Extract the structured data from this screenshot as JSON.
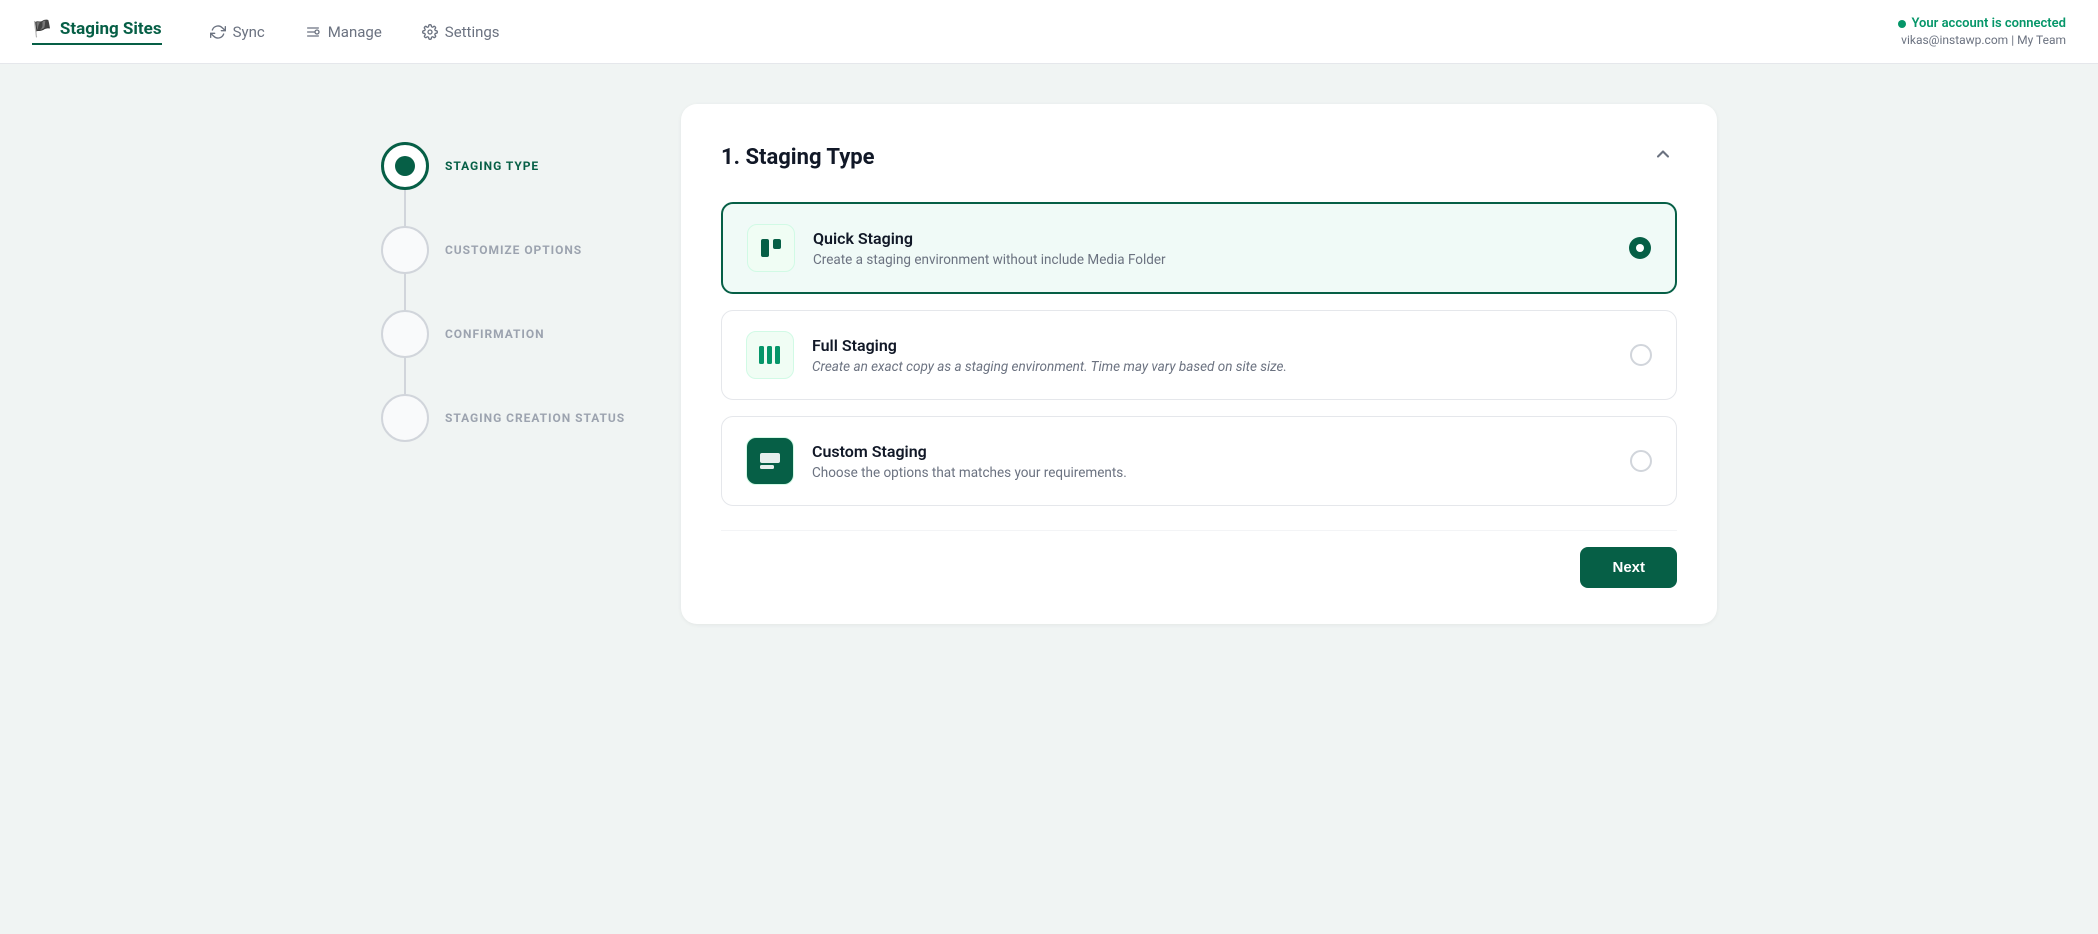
{
  "navbar": {
    "brand": "Staging Sites",
    "nav_items": [
      {
        "id": "sync",
        "label": "Sync",
        "icon": "sync"
      },
      {
        "id": "manage",
        "label": "Manage",
        "icon": "manage"
      },
      {
        "id": "settings",
        "label": "Settings",
        "icon": "settings"
      }
    ],
    "account_status": "Your account is connected",
    "account_email": "vikas@instawp.com",
    "account_team": "My Team"
  },
  "steps": [
    {
      "id": "staging-type",
      "label": "STAGING TYPE",
      "active": true
    },
    {
      "id": "customize",
      "label": "CUSTOMIZE OPTIONS",
      "active": false
    },
    {
      "id": "confirmation",
      "label": "CONFIRMATION",
      "active": false
    },
    {
      "id": "creation-status",
      "label": "STAGING CREATION STATUS",
      "active": false
    }
  ],
  "section": {
    "title": "1. Staging Type",
    "options": [
      {
        "id": "quick",
        "title": "Quick Staging",
        "desc": "Create a staging environment without include Media Folder",
        "selected": true,
        "icon_type": "quick"
      },
      {
        "id": "full",
        "title": "Full Staging",
        "desc": "Create an exact copy as a staging environment. Time may vary based on site size.",
        "selected": false,
        "icon_type": "full"
      },
      {
        "id": "custom",
        "title": "Custom Staging",
        "desc": "Choose the options that matches your requirements.",
        "selected": false,
        "icon_type": "custom"
      }
    ],
    "next_button": "Next"
  }
}
